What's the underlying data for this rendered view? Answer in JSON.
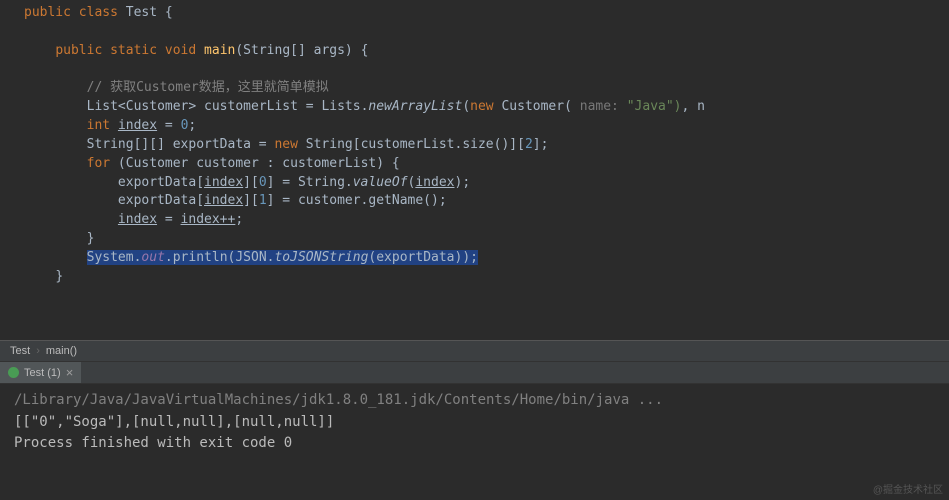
{
  "code": {
    "class_decl": {
      "kw1": "public",
      "kw2": "class",
      "name": "Test",
      "brace": "{"
    },
    "main_decl": {
      "kw1": "public",
      "kw2": "static",
      "kw3": "void",
      "name": "main",
      "params": "(String[] args)",
      "brace": "{"
    },
    "comment1": "// 获取Customer数据，这里就简单模拟",
    "line_list": {
      "type": "List<Customer>",
      "var": "customerList",
      "eq": "=",
      "lists": "Lists",
      "dot": ".",
      "newarr": "newArrayList",
      "open": "(",
      "new_kw": "new",
      "cust": "Customer",
      "hint": " name: ",
      "strv": "\"Java\")",
      "tail": ", n"
    },
    "line_int": {
      "kw": "int",
      "var": "index",
      "eq": "=",
      "val": "0",
      "semi": ";"
    },
    "line_export": {
      "p1": "String[][] exportData = ",
      "new_kw": "new",
      "p2": " String[customerList.size()][",
      "two": "2",
      "p3": "];"
    },
    "line_for": {
      "kw": "for",
      "rest": " (Customer customer : customerList) {"
    },
    "line_e0": {
      "p1": "exportData[",
      "idx": "index",
      "p2": "][",
      "n": "0",
      "p3": "] = String.",
      "valof": "valueOf",
      "open": "(",
      "idx2": "index",
      "close": ");"
    },
    "line_e1": {
      "p1": "exportData[",
      "idx": "index",
      "p2": "][",
      "n": "1",
      "p3": "] = customer.getName();"
    },
    "line_inc": {
      "idx1": "index",
      "eq": " = ",
      "idx2": "index++",
      "semi": ";"
    },
    "line_brace_close": "}",
    "line_sys": {
      "sys": "System",
      "dot1": ".",
      "out": "out",
      "dot2": ".",
      "println": "println(JSON",
      "dot3": ".",
      "tojson": "toJSONString",
      "args": "(exportData));"
    },
    "method_close": "}"
  },
  "breadcrumb": {
    "item1": "Test",
    "item2": "main()"
  },
  "runtab": {
    "label": "Test (1)",
    "close": "×"
  },
  "console": {
    "path": "/Library/Java/JavaVirtualMachines/jdk1.8.0_181.jdk/Contents/Home/bin/java ...",
    "output": "[[\"0\",\"Soga\"],[null,null],[null,null]]",
    "blank": " ",
    "exit": "Process finished with exit code 0"
  },
  "watermark": "@掘金技术社区"
}
